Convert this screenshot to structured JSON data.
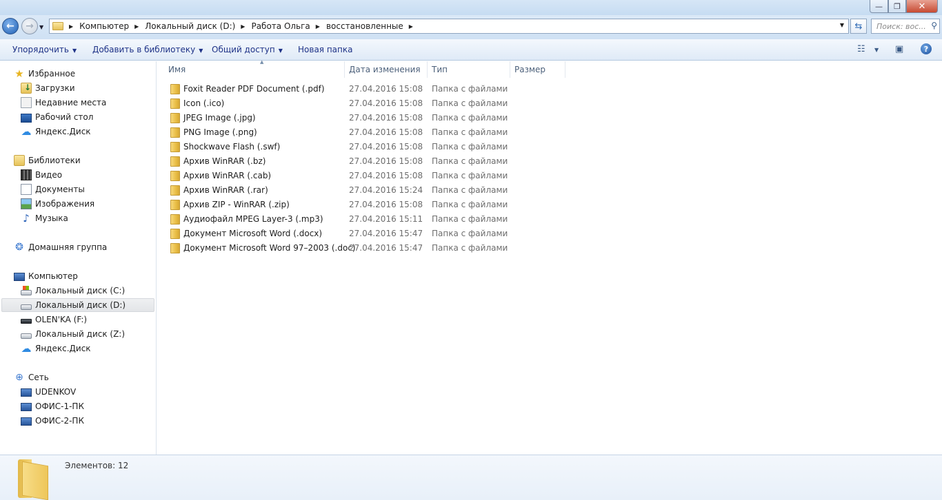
{
  "window": {
    "minimize_symbol": "—",
    "maximize_symbol": "❐",
    "close_symbol": "✕"
  },
  "address_bar": {
    "breadcrumbs": [
      "Компьютер",
      "Локальный диск (D:)",
      "Работа Ольга",
      "восстановленные"
    ],
    "search_placeholder": "Поиск: вос..."
  },
  "toolbar": {
    "organize": "Упорядочить",
    "add_to_library": "Добавить в библиотеку",
    "share": "Общий доступ",
    "new_folder": "Новая папка",
    "help_symbol": "?"
  },
  "columns": {
    "name": "Имя",
    "date": "Дата изменения",
    "type": "Тип",
    "size": "Размер"
  },
  "nav": {
    "favorites": {
      "header": "Избранное",
      "items": [
        "Загрузки",
        "Недавние места",
        "Рабочий стол",
        "Яндекс.Диск"
      ]
    },
    "libraries": {
      "header": "Библиотеки",
      "items": [
        "Видео",
        "Документы",
        "Изображения",
        "Музыка"
      ]
    },
    "homegroup": "Домашняя группа",
    "computer": {
      "header": "Компьютер",
      "items": [
        "Локальный диск (C:)",
        "Локальный диск (D:)",
        "OLEN'KA (F:)",
        "Локальный диск (Z:)",
        "Яндекс.Диск"
      ]
    },
    "network": {
      "header": "Сеть",
      "items": [
        "UDENKOV",
        "ОФИС-1-ПК",
        "ОФИС-2-ПК"
      ]
    }
  },
  "files": [
    {
      "name": "Foxit Reader PDF Document (.pdf)",
      "date": "27.04.2016 15:08",
      "type": "Папка с файлами"
    },
    {
      "name": "Icon (.ico)",
      "date": "27.04.2016 15:08",
      "type": "Папка с файлами"
    },
    {
      "name": "JPEG Image (.jpg)",
      "date": "27.04.2016 15:08",
      "type": "Папка с файлами"
    },
    {
      "name": "PNG Image (.png)",
      "date": "27.04.2016 15:08",
      "type": "Папка с файлами"
    },
    {
      "name": "Shockwave Flash (.swf)",
      "date": "27.04.2016 15:08",
      "type": "Папка с файлами"
    },
    {
      "name": "Архив WinRAR (.bz)",
      "date": "27.04.2016 15:08",
      "type": "Папка с файлами"
    },
    {
      "name": "Архив WinRAR (.cab)",
      "date": "27.04.2016 15:08",
      "type": "Папка с файлами"
    },
    {
      "name": "Архив WinRAR (.rar)",
      "date": "27.04.2016 15:24",
      "type": "Папка с файлами"
    },
    {
      "name": "Архив ZIP - WinRAR (.zip)",
      "date": "27.04.2016 15:08",
      "type": "Папка с файлами"
    },
    {
      "name": "Аудиофайл MPEG Layer-3 (.mp3)",
      "date": "27.04.2016 15:11",
      "type": "Папка с файлами"
    },
    {
      "name": "Документ Microsoft Word (.docx)",
      "date": "27.04.2016 15:47",
      "type": "Папка с файлами"
    },
    {
      "name": "Документ Microsoft Word 97–2003 (.doc)",
      "date": "27.04.2016 15:47",
      "type": "Папка с файлами"
    }
  ],
  "status": {
    "item_count": "Элементов: 12"
  }
}
